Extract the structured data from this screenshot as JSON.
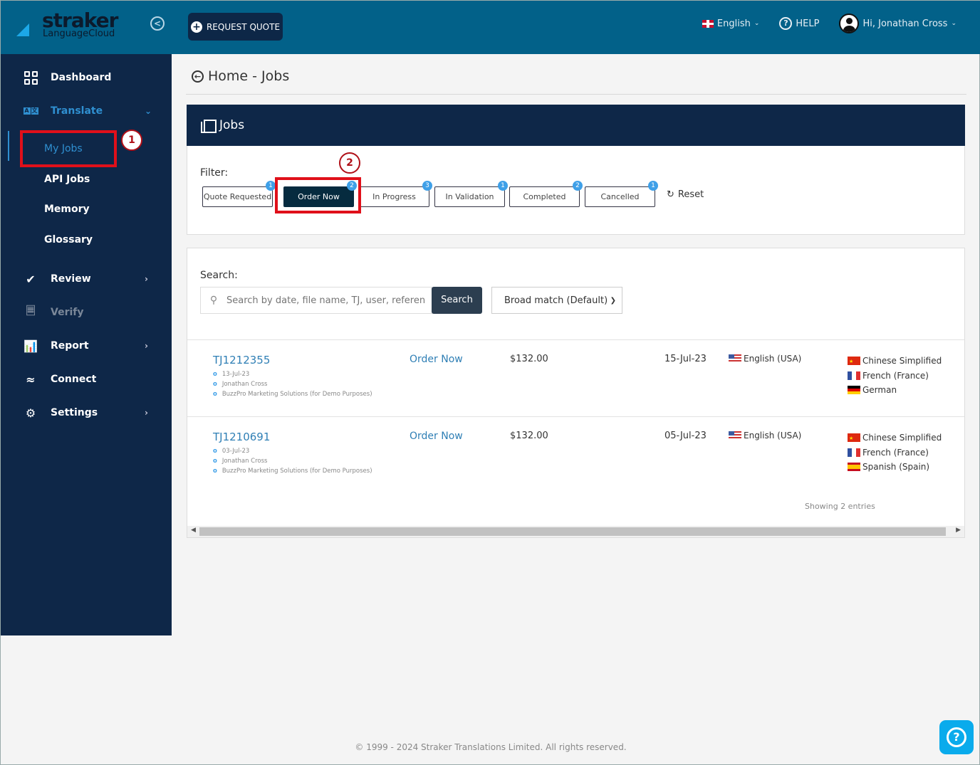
{
  "header": {
    "logo_word": "straker",
    "logo_sub": "LanguageCloud",
    "request_quote_label": "REQUEST QUOTE",
    "language_label": "English",
    "help_label": "HELP",
    "user_greeting": "Hi, Jonathan Cross"
  },
  "sidebar": {
    "items": [
      {
        "label": "Dashboard",
        "icon": "grid-icon"
      },
      {
        "label": "Translate",
        "icon": "translate-icon",
        "expanded": true
      },
      {
        "label": "Review",
        "icon": "check-circle-icon"
      },
      {
        "label": "Verify",
        "icon": "document-check-icon",
        "disabled": true
      },
      {
        "label": "Report",
        "icon": "report-icon"
      },
      {
        "label": "Connect",
        "icon": "connect-icon"
      },
      {
        "label": "Settings",
        "icon": "gear-icon"
      }
    ],
    "translate_sub": [
      "My Jobs",
      "API Jobs",
      "Memory",
      "Glossary"
    ]
  },
  "annotations": {
    "step1": "1",
    "step2": "2"
  },
  "page": {
    "breadcrumb": "Home - Jobs",
    "panel_title": "Jobs"
  },
  "filter": {
    "label": "Filter:",
    "buttons": [
      {
        "label": "Quote Requested",
        "count": "1"
      },
      {
        "label": "Order Now",
        "count": "2",
        "active": true
      },
      {
        "label": "In Progress",
        "count": "3"
      },
      {
        "label": "In Validation",
        "count": "1"
      },
      {
        "label": "Completed",
        "count": "2"
      },
      {
        "label": "Cancelled",
        "count": "1"
      }
    ],
    "reset_label": "Reset"
  },
  "search": {
    "label": "Search:",
    "placeholder": "Search by date, file name, TJ, user, reference, group",
    "value": "",
    "button_label": "Search",
    "match_mode": "Broad match (Default)"
  },
  "jobs": [
    {
      "id": "TJ1212355",
      "created": "13-Jul-23",
      "user": "Jonathan Cross",
      "company": "BuzzPro Marketing Solutions (for Demo Purposes)",
      "status": "Order Now",
      "price": "$132.00",
      "due": "15-Jul-23",
      "source": {
        "lang": "English (USA)",
        "flag": "us"
      },
      "targets": [
        {
          "lang": "Chinese Simplified",
          "flag": "cn"
        },
        {
          "lang": "French (France)",
          "flag": "fr"
        },
        {
          "lang": "German",
          "flag": "de"
        }
      ]
    },
    {
      "id": "TJ1210691",
      "created": "03-Jul-23",
      "user": "Jonathan Cross",
      "company": "BuzzPro Marketing Solutions (for Demo Purposes)",
      "status": "Order Now",
      "price": "$132.00",
      "due": "05-Jul-23",
      "source": {
        "lang": "English (USA)",
        "flag": "us"
      },
      "targets": [
        {
          "lang": "Chinese Simplified",
          "flag": "cn"
        },
        {
          "lang": "French (France)",
          "flag": "fr"
        },
        {
          "lang": "Spanish (Spain)",
          "flag": "es"
        }
      ]
    }
  ],
  "showing_text": "Showing 2 entries",
  "footer": "© 1999 - 2024 Straker Translations Limited. All rights reserved.",
  "colors": {
    "topbar": "#026189",
    "sidebar": "#0e2748",
    "accent": "#2f8fd0",
    "annotation": "#e0101a",
    "badge": "#3fa0e8"
  }
}
